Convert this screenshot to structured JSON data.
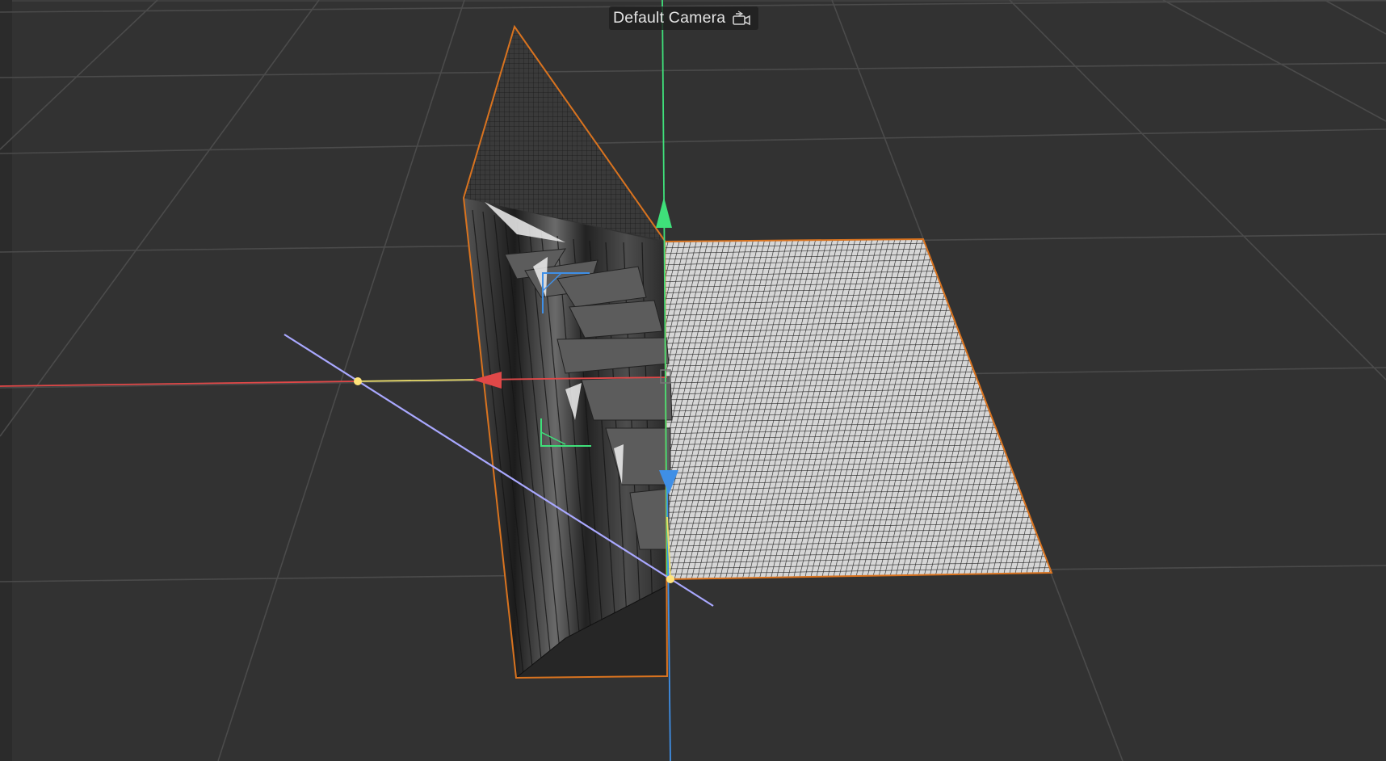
{
  "viewport": {
    "camera_label": "Default Camera",
    "camera_icon": "camera-switch-icon",
    "colors": {
      "background": "#323232",
      "grid_line": "#4a4a4a",
      "selection_outline": "#d9731f",
      "axis_x": "#e04848",
      "axis_y": "#3fe07a",
      "axis_z": "#3f8fe6",
      "pivot_line": "#a9a8ff",
      "pivot_handle": "#ffe37a",
      "mesh_dark": "#2c2c2c",
      "mesh_light": "#d8d8d8"
    }
  }
}
